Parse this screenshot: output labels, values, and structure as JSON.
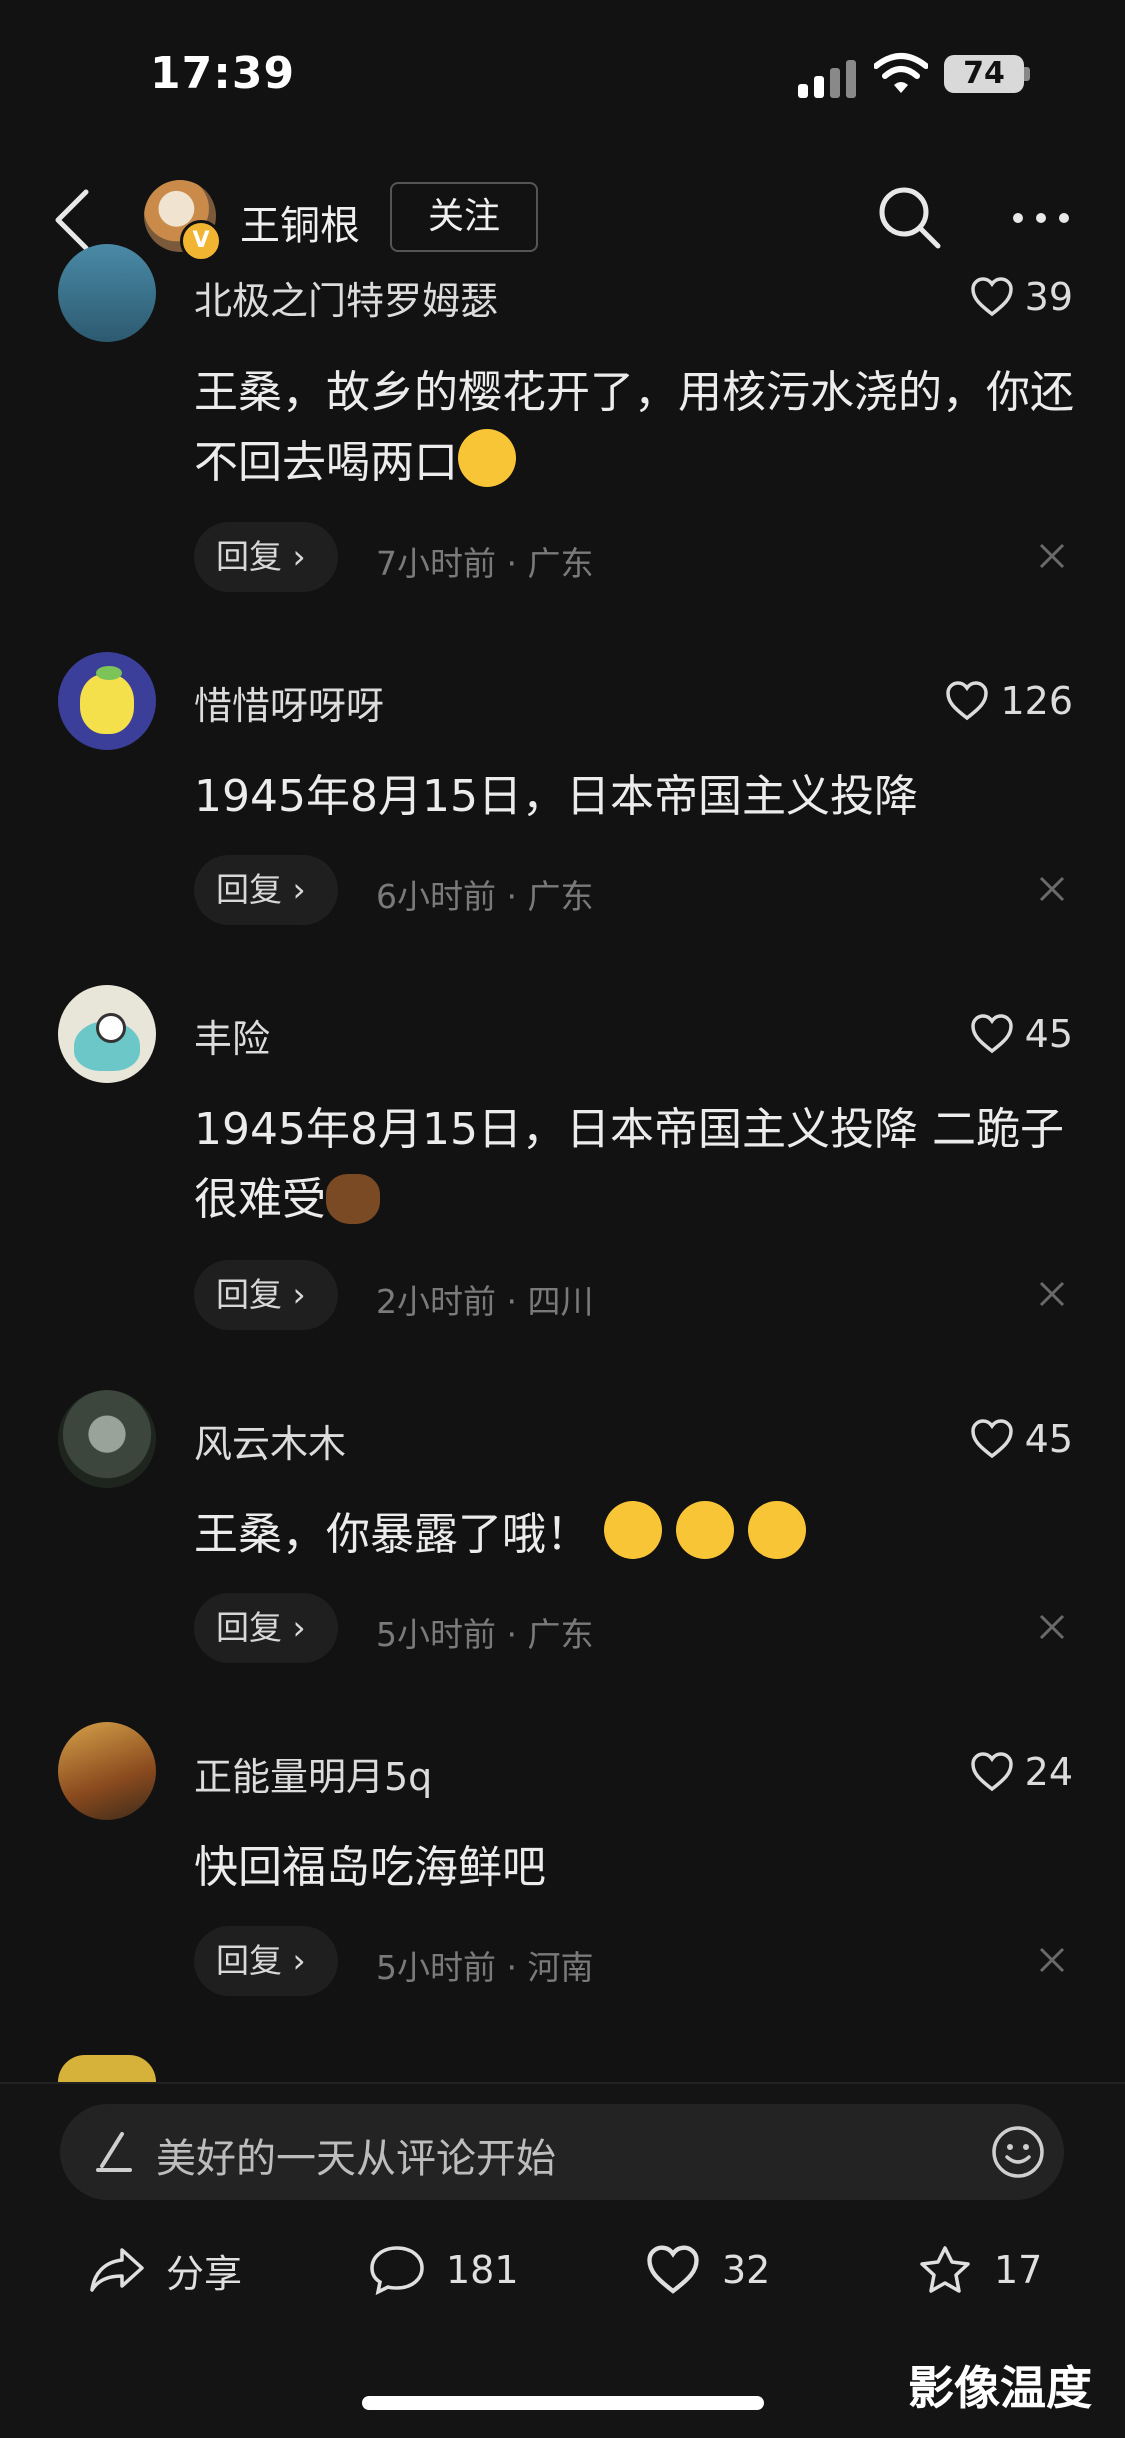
{
  "status": {
    "time": "17:39",
    "battery": "74"
  },
  "header": {
    "name": "王铜根",
    "follow_label": "关注",
    "verified_mark": "V"
  },
  "comments": [
    {
      "name": "北极之门特罗姆瑟",
      "likes": "39",
      "text": "王桑，故乡的樱花开了，用核污水浇的，你还不回去喝两口",
      "emoji": "laughing-face",
      "reply": "回复",
      "chevron": "›",
      "time": "7小时前",
      "sep": "·",
      "location": "广东"
    },
    {
      "name": "惜惜呀呀呀",
      "likes": "126",
      "text": "1945年8月15日，日本帝国主义投降",
      "emoji": "",
      "reply": "回复",
      "chevron": "›",
      "time": "6小时前",
      "sep": "·",
      "location": "广东"
    },
    {
      "name": "丰险",
      "likes": "45",
      "text": "1945年8月15日，日本帝国主义投降 二跪子很难受",
      "emoji": "poop",
      "reply": "回复",
      "chevron": "›",
      "time": "2小时前",
      "sep": "·",
      "location": "四川"
    },
    {
      "name": "风云木木",
      "likes": "45",
      "text": "王桑，你暴露了哦！",
      "emoji": "crying-faces",
      "reply": "回复",
      "chevron": "›",
      "time": "5小时前",
      "sep": "·",
      "location": "广东"
    },
    {
      "name": "正能量明月5q",
      "likes": "24",
      "text": "快回福岛吃海鲜吧",
      "emoji": "",
      "reply": "回复",
      "chevron": "›",
      "time": "5小时前",
      "sep": "·",
      "location": "河南"
    }
  ],
  "composer": {
    "placeholder": "美好的一天从评论开始"
  },
  "actions": {
    "share_label": "分享",
    "comments": "181",
    "likes": "32",
    "favorites": "17"
  },
  "watermark": "影像温度",
  "colors": {
    "background": "#121212",
    "badge": "#f2b531"
  }
}
